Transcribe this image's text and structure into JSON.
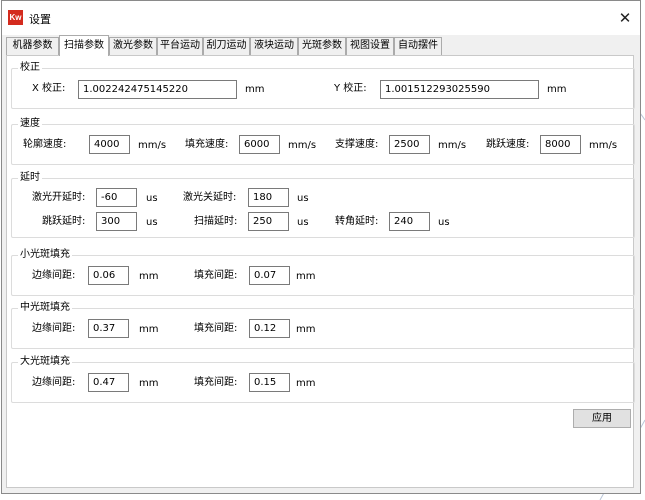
{
  "window": {
    "title": "设置",
    "logo": "Kw"
  },
  "tabs": [
    "机器参数",
    "扫描参数",
    "激光参数",
    "平台运动",
    "刮刀运动",
    "液块运动",
    "光斑参数",
    "视图设置",
    "自动摆件"
  ],
  "active_tab": 1,
  "calibration": {
    "title": "校正",
    "x_label": "X 校正:",
    "x_value": "1.002242475145220",
    "x_unit": "mm",
    "y_label": "Y 校正:",
    "y_value": "1.001512293025590",
    "y_unit": "mm"
  },
  "speed": {
    "title": "速度",
    "contour_label": "轮廓速度:",
    "contour_value": "4000",
    "contour_unit": "mm/s",
    "fill_label": "填充速度:",
    "fill_value": "6000",
    "fill_unit": "mm/s",
    "support_label": "支撑速度:",
    "support_value": "2500",
    "support_unit": "mm/s",
    "jump_label": "跳跃速度:",
    "jump_value": "8000",
    "jump_unit": "mm/s"
  },
  "delay": {
    "title": "延时",
    "laser_on_label": "激光开延时:",
    "laser_on_value": "-60",
    "laser_on_unit": "us",
    "laser_off_label": "激光关延时:",
    "laser_off_value": "180",
    "laser_off_unit": "us",
    "jump_label": "跳跃延时:",
    "jump_value": "300",
    "jump_unit": "us",
    "scan_label": "扫描延时:",
    "scan_value": "250",
    "scan_unit": "us",
    "corner_label": "转角延时:",
    "corner_value": "240",
    "corner_unit": "us"
  },
  "small_spot": {
    "title": "小光斑填充",
    "edge_label": "边缘间距:",
    "edge_value": "0.06",
    "edge_unit": "mm",
    "fill_label": "填充间距:",
    "fill_value": "0.07",
    "fill_unit": "mm"
  },
  "medium_spot": {
    "title": "中光斑填充",
    "edge_label": "边缘间距:",
    "edge_value": "0.37",
    "edge_unit": "mm",
    "fill_label": "填充间距:",
    "fill_value": "0.12",
    "fill_unit": "mm"
  },
  "large_spot": {
    "title": "大光斑填充",
    "edge_label": "边缘间距:",
    "edge_value": "0.47",
    "edge_unit": "mm",
    "fill_label": "填充间距:",
    "fill_value": "0.15",
    "fill_unit": "mm"
  },
  "apply_label": "应用",
  "icons": {
    "close": "close-icon",
    "logo": "app-logo-icon"
  }
}
